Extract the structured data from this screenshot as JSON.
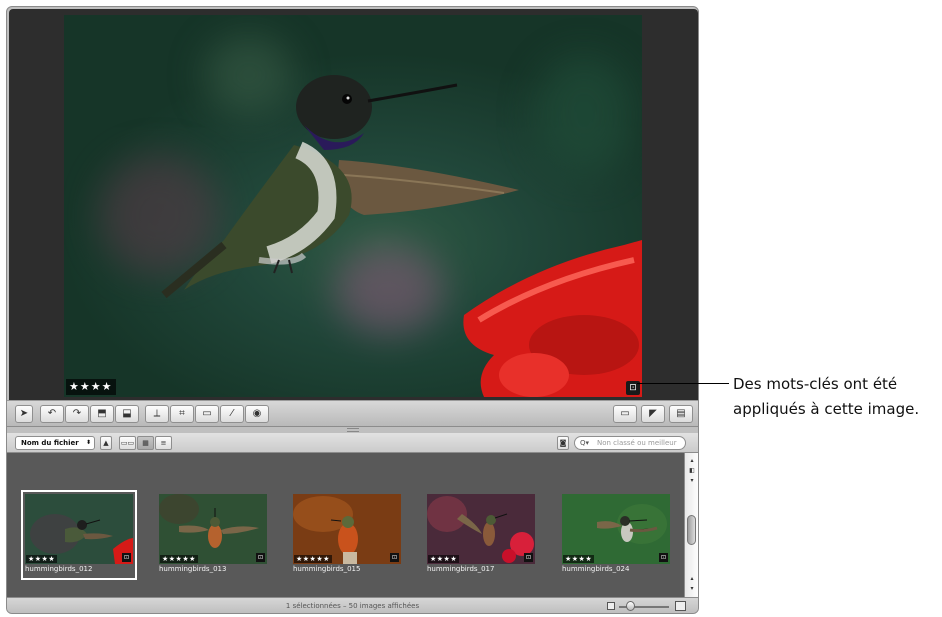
{
  "viewer": {
    "rating_stars": "★★★★",
    "keyword_badge_icon": "keyword-tag-icon"
  },
  "toolbar": {
    "tools": [
      "select-tool",
      "rotate-left-tool",
      "rotate-right-tool",
      "lift-tool",
      "stamp-tool",
      "straighten-tool",
      "crop-tool",
      "red-eye-tool",
      "retouch-tool",
      "target-tool"
    ],
    "right_buttons": [
      "viewer-mode",
      "flag",
      "info"
    ]
  },
  "browser": {
    "sort_label": "Nom du fichier",
    "search_placeholder": "Non classé ou meilleur",
    "thumbnails": [
      {
        "name": "hummingbirds_012",
        "stars": "★★★★",
        "selected": true
      },
      {
        "name": "hummingbirds_013",
        "stars": "★★★★★",
        "selected": false
      },
      {
        "name": "hummingbirds_015",
        "stars": "★★★★★",
        "selected": false
      },
      {
        "name": "hummingbirds_017",
        "stars": "★★★★",
        "selected": false
      },
      {
        "name": "hummingbirds_024",
        "stars": "★★★★",
        "selected": false
      }
    ],
    "status": "1 sélectionnées – 50 images affichées"
  },
  "callout": {
    "line1": "Des mots-clés ont été",
    "line2": "appliqués à cette image."
  },
  "colors": {
    "viewer_bg": "#2d2d2d",
    "filmstrip_bg": "#595959",
    "feeder_red": "#e0201c"
  }
}
